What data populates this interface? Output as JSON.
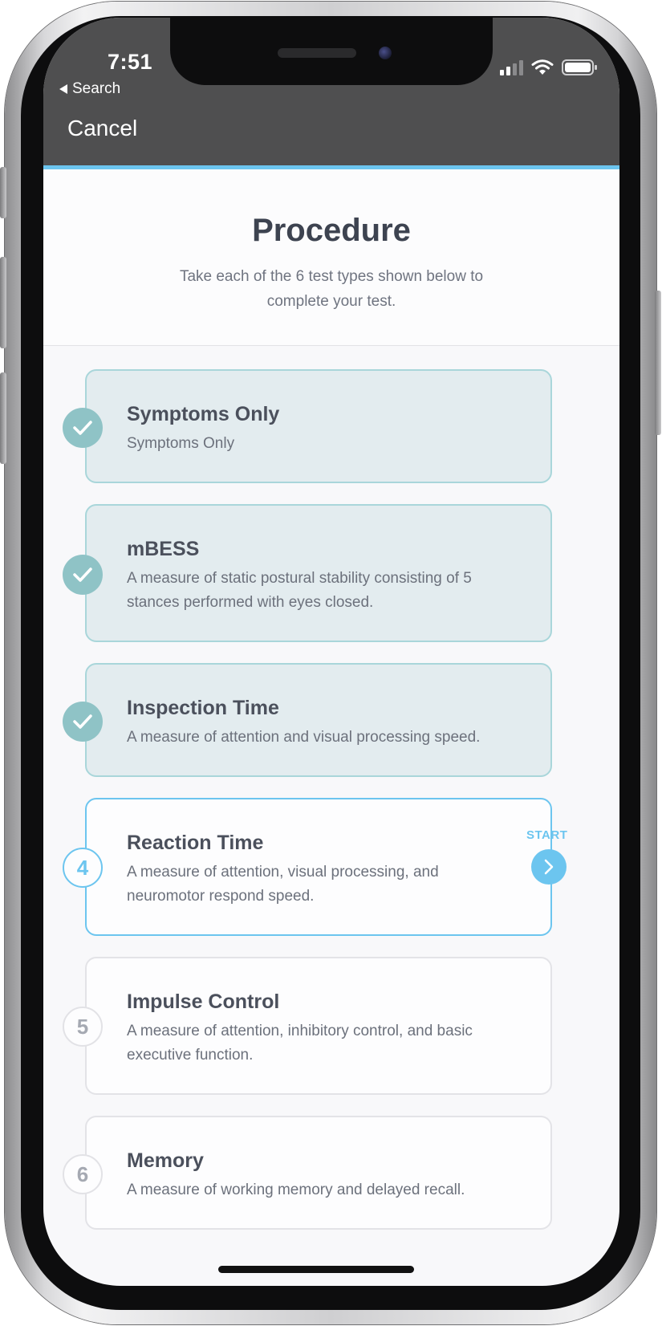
{
  "status_bar": {
    "time": "7:51",
    "back_label": "Search"
  },
  "nav": {
    "cancel_label": "Cancel"
  },
  "header": {
    "title": "Procedure",
    "subtitle": "Take each of the 6 test types shown below to complete your test."
  },
  "steps": [
    {
      "title": "Symptoms Only",
      "description": "Symptoms Only",
      "state": "complete"
    },
    {
      "title": "mBESS",
      "description": "A measure of static postural stability consisting of 5 stances performed with eyes closed.",
      "state": "complete"
    },
    {
      "title": "Inspection Time",
      "description": "A measure of attention and visual processing speed.",
      "state": "complete"
    },
    {
      "title": "Reaction Time",
      "description": "A measure of attention, visual processing, and neuromotor respond speed.",
      "state": "current",
      "number": "4",
      "action_label": "START"
    },
    {
      "title": "Impulse Control",
      "description": "A measure of attention, inhibitory control, and basic executive function.",
      "state": "pending",
      "number": "5"
    },
    {
      "title": "Memory",
      "description": "A measure of working memory and delayed recall.",
      "state": "pending",
      "number": "6"
    }
  ],
  "colors": {
    "accent": "#6cc5ef",
    "complete": "#8fc3c6",
    "nav_bar": "#4f4f50"
  }
}
